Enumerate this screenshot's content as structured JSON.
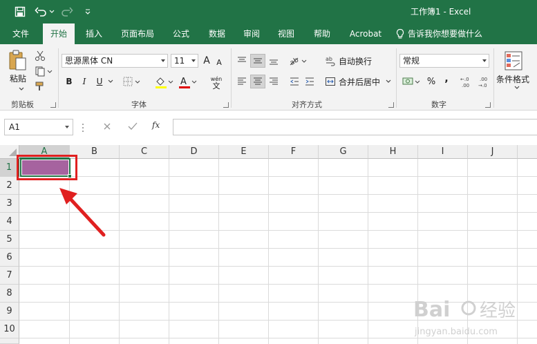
{
  "window": {
    "title": "工作簿1  -   Excel"
  },
  "quick_access": {
    "save_icon": "save-icon",
    "undo_icon": "undo-icon",
    "redo_icon": "redo-icon",
    "customize_icon": "customize-qat-icon"
  },
  "tabs": [
    {
      "label": "文件",
      "active": false
    },
    {
      "label": "开始",
      "active": true
    },
    {
      "label": "插入",
      "active": false
    },
    {
      "label": "页面布局",
      "active": false
    },
    {
      "label": "公式",
      "active": false
    },
    {
      "label": "数据",
      "active": false
    },
    {
      "label": "审阅",
      "active": false
    },
    {
      "label": "视图",
      "active": false
    },
    {
      "label": "帮助",
      "active": false
    },
    {
      "label": "Acrobat",
      "active": false
    }
  ],
  "tell_me": "告诉我你想要做什么",
  "ribbon": {
    "clipboard": {
      "label": "剪贴板",
      "paste": "粘贴"
    },
    "font": {
      "label": "字体",
      "name": "思源黑体 CN",
      "size": "11",
      "bold": "B",
      "italic": "I",
      "underline": "U",
      "wen": "wén",
      "wen_char": "文",
      "increase": "A",
      "decrease": "A",
      "font_color": "#e00000",
      "fill_color": "#ffff00"
    },
    "alignment": {
      "label": "对齐方式",
      "wrap_text": "自动换行",
      "merge_center": "合并后居中"
    },
    "number": {
      "label": "数字",
      "format": "常规",
      "percent": "%",
      "comma": ",",
      "inc_decimal": "←.0\n.00",
      "dec_decimal": ".00\n→.0"
    },
    "styles": {
      "conditional_format": "条件格式"
    }
  },
  "formula_bar": {
    "name_box": "A1",
    "fx": "fx",
    "value": ""
  },
  "sheet": {
    "columns": [
      "A",
      "B",
      "C",
      "D",
      "E",
      "F",
      "G",
      "H",
      "I",
      "J"
    ],
    "rows": [
      "1",
      "2",
      "3",
      "4",
      "5",
      "6",
      "7",
      "8",
      "9",
      "10"
    ],
    "selected_cell": "A1",
    "selected_cell_fill": "#a6639f",
    "highlight_color": "#e02020",
    "accent": "#217346"
  },
  "watermark": {
    "brand": "Baidu经验",
    "url": "jingyan.baidu.com"
  }
}
